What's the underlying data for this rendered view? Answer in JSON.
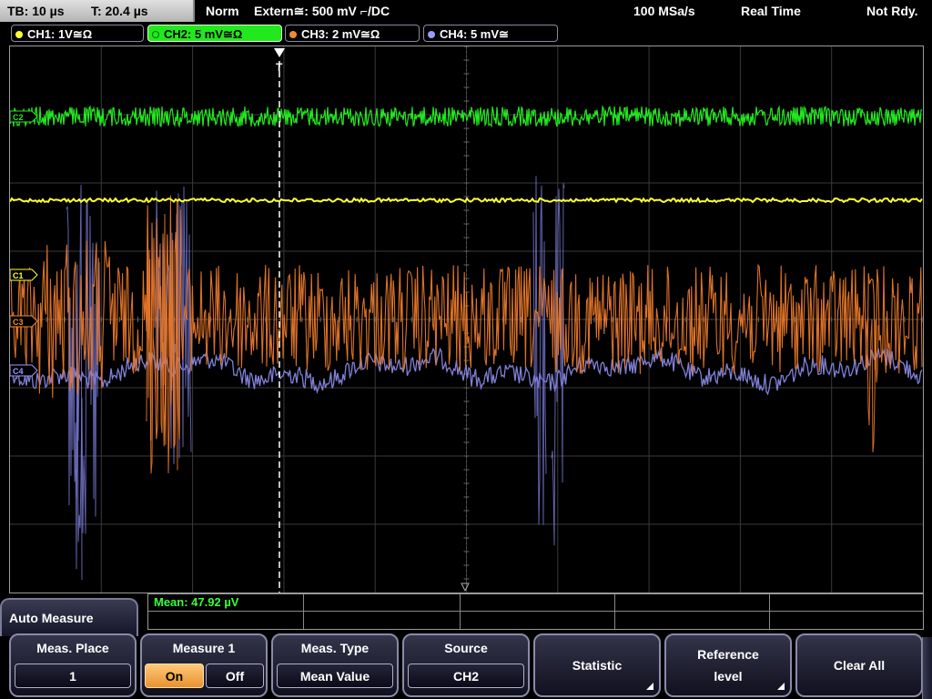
{
  "status": {
    "timebase": "TB: 10 µs",
    "trigger_time": "T: 20.4 µs",
    "mode": "Norm",
    "trigger_source": "Extern≅: 500 mV ⌐/DC",
    "sample_rate": "100 MSa/s",
    "acquisition": "Real Time",
    "state": "Not Rdy."
  },
  "channels": [
    {
      "label": "CH1: 1V≅Ω",
      "color": "#ffff33",
      "active": false
    },
    {
      "label": "CH2: 5 mV≅Ω",
      "color": "#22e81e",
      "active": true
    },
    {
      "label": "CH3: 2 mV≅Ω",
      "color": "#f08a30",
      "active": false
    },
    {
      "label": "CH4: 5 mV≅",
      "color": "#9a9aff",
      "active": false
    }
  ],
  "markers": {
    "c2": "C2",
    "c1": "C1",
    "c3": "C3",
    "c4": "C4",
    "trigger": "T"
  },
  "measurement": {
    "mean": "Mean: 47.92 µV"
  },
  "menu": {
    "title": "Auto Measure",
    "keys": {
      "meas_place": {
        "label": "Meas. Place",
        "value": "1"
      },
      "measure": {
        "label": "Measure 1",
        "on": "On",
        "off": "Off"
      },
      "meas_type": {
        "label": "Meas. Type",
        "value": "Mean Value"
      },
      "source": {
        "label": "Source",
        "value": "CH2"
      },
      "statistic": {
        "label": "Statistic"
      },
      "reference": {
        "label1": "Reference",
        "label2": "level"
      },
      "clear": {
        "label": "Clear All"
      }
    }
  }
}
